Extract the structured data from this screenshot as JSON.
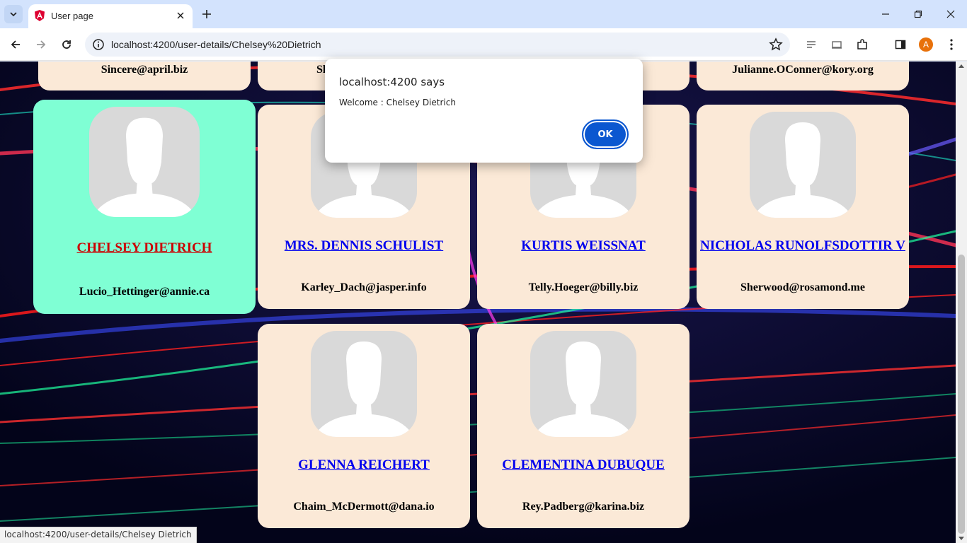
{
  "browser": {
    "tab_title": "User page",
    "url": "localhost:4200/user-details/Chelsey%20Dietrich",
    "profile_initial": "A",
    "status_text": "localhost:4200/user-details/Chelsey Dietrich"
  },
  "dialog": {
    "title": "localhost:4200 says",
    "message": "Welcome : Chelsey Dietrich",
    "ok_label": "OK"
  },
  "cards_top_row": [
    {
      "email": "Sincere@april.biz"
    },
    {
      "email": "Sh"
    },
    {
      "email": ""
    },
    {
      "email": "Julianne.OConner@kory.org"
    }
  ],
  "cards": [
    {
      "name": "CHELSEY DIETRICH",
      "email": "Lucio_Hettinger@annie.ca",
      "selected": true
    },
    {
      "name": "MRS. DENNIS SCHULIST",
      "email": "Karley_Dach@jasper.info"
    },
    {
      "name": "KURTIS WEISSNAT",
      "email": "Telly.Hoeger@billy.biz"
    },
    {
      "name": "NICHOLAS RUNOLFSDOTTIR V",
      "email": "Sherwood@rosamond.me"
    },
    {
      "name": "GLENNA REICHERT",
      "email": "Chaim_McDermott@dana.io"
    },
    {
      "name": "CLEMENTINA DUBUQUE",
      "email": "Rey.Padberg@karina.biz"
    }
  ],
  "colors": {
    "card_bg": "#fbe9d7",
    "selected_card_bg": "#7fffd4",
    "link": "#0000ee",
    "selected_link": "#cc0000",
    "dialog_button": "#0b57d0"
  }
}
